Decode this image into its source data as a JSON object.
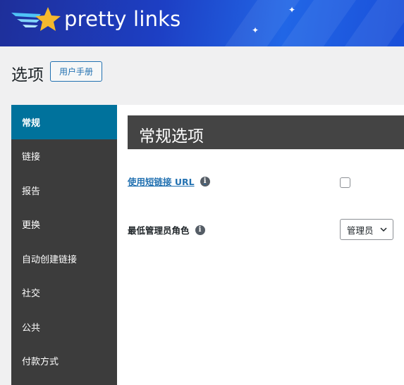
{
  "brand": {
    "name": "pretty links",
    "banner_color": "#1d3fc4",
    "star_color": "#f5b82e",
    "wing_color": "#4fc3f7"
  },
  "page": {
    "title": "选项",
    "manual_button": "用户手册"
  },
  "sidebar": {
    "items": [
      {
        "label": "常规",
        "active": true
      },
      {
        "label": "链接",
        "active": false
      },
      {
        "label": "报告",
        "active": false
      },
      {
        "label": "更换",
        "active": false
      },
      {
        "label": "自动创建链接",
        "active": false
      },
      {
        "label": "社交",
        "active": false
      },
      {
        "label": "公共",
        "active": false
      },
      {
        "label": "付款方式",
        "active": false
      }
    ],
    "active_color": "#00729c"
  },
  "main": {
    "section_title": "常规选项",
    "settings": [
      {
        "label": "使用短链接 URL",
        "icon": "info-icon",
        "control": "checkbox",
        "checked": false
      },
      {
        "label": "最低管理员角色",
        "icon": "info-icon",
        "control": "select",
        "value": "管理员"
      }
    ]
  }
}
